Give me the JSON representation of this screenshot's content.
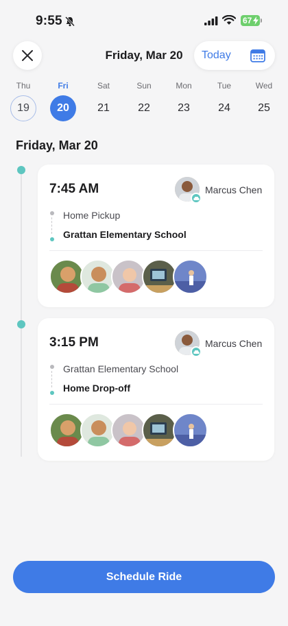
{
  "status_bar": {
    "time": "9:55",
    "battery": "67",
    "icons": [
      "bell-slash-icon",
      "signal-icon",
      "wifi-icon",
      "battery-icon"
    ]
  },
  "header": {
    "close_icon": "close-icon",
    "date": "Friday, Mar 20",
    "today_label": "Today",
    "calendar_icon": "calendar-icon"
  },
  "week": [
    {
      "name": "Thu",
      "num": "19"
    },
    {
      "name": "Fri",
      "num": "20"
    },
    {
      "name": "Sat",
      "num": "21"
    },
    {
      "name": "Sun",
      "num": "22"
    },
    {
      "name": "Mon",
      "num": "23"
    },
    {
      "name": "Tue",
      "num": "24"
    },
    {
      "name": "Wed",
      "num": "25"
    }
  ],
  "section_title": "Friday, Mar 20",
  "rides": [
    {
      "time": "7:45 AM",
      "driver": "Marcus Chen",
      "from": "Home Pickup",
      "to": "Grattan Elementary School"
    },
    {
      "time": "3:15 PM",
      "driver": "Marcus Chen",
      "from": "Grattan Elementary School",
      "to": "Home Drop-off"
    }
  ],
  "colors": {
    "accent": "#3f7be6",
    "teal": "#5ec6c0",
    "background": "#f5f5f6"
  },
  "schedule_button": "Schedule Ride"
}
